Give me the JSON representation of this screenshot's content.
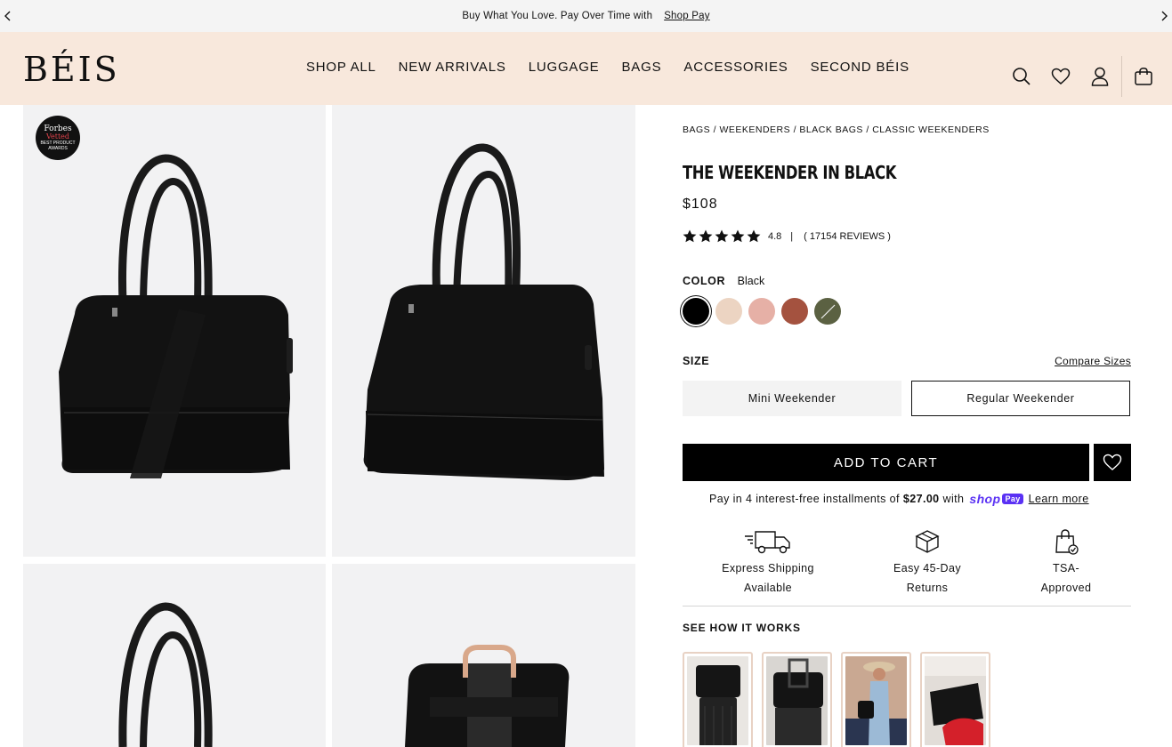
{
  "announcement": {
    "text": "Buy What You Love. Pay Over Time with",
    "link": "Shop Pay"
  },
  "header": {
    "logo": "BÉIS",
    "nav": [
      "SHOP ALL",
      "NEW ARRIVALS",
      "LUGGAGE",
      "BAGS",
      "ACCESSORIES",
      "SECOND BÉIS"
    ],
    "icons": [
      "search-icon",
      "heart-icon",
      "account-icon",
      "cart-icon"
    ]
  },
  "gallery": {
    "badge": {
      "line1": "Forbes",
      "line2": "Vetted",
      "line3": "BEST PRODUCT",
      "line4": "AWARDS"
    }
  },
  "product": {
    "breadcrumbs": [
      "BAGS",
      "WEEKENDERS",
      "BLACK BAGS",
      "CLASSIC WEEKENDERS"
    ],
    "title": "The Weekender in Black",
    "price": "$108",
    "rating": {
      "value": "4.8",
      "stars": 5,
      "reviews": "( 17154 REVIEWS )"
    },
    "color": {
      "label": "COLOR",
      "selected": "Black",
      "swatches": [
        "#000000",
        "#ecd4c2",
        "#e6b0a6",
        "#a4523f",
        "#5b6142"
      ]
    },
    "size": {
      "label": "SIZE",
      "compare": "Compare Sizes",
      "options": [
        "Mini Weekender",
        "Regular Weekender"
      ]
    },
    "add_to_cart": "ADD TO CART",
    "installments": {
      "prefix": "Pay in 4 interest-free installments of",
      "amount": "$27.00",
      "with": "with",
      "shop": "shop",
      "pay": "Pay",
      "learn_more": "Learn more"
    },
    "perks": [
      {
        "line1": "Express Shipping",
        "line2": "Available",
        "icon": "truck-icon"
      },
      {
        "line1": "Easy 45-Day",
        "line2": "Returns",
        "icon": "box-icon"
      },
      {
        "line1": "TSA-",
        "line2": "Approved",
        "icon": "shopping-bag-check-icon"
      }
    ],
    "how_it_works": "SEE HOW IT WORKS"
  },
  "colors": {
    "announce_bg": "#f4f4f4",
    "header_bg": "#f8e8dc",
    "gallery_bg": "#f2f2f3",
    "shop_pay": "#5a31f4"
  }
}
